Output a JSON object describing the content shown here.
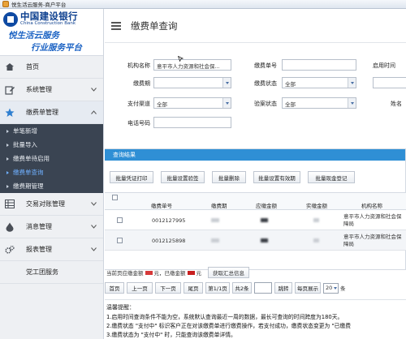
{
  "window": {
    "title": "悦生活云服务-商户平台"
  },
  "brand": {
    "bank_cn": "中国建设银行",
    "bank_en": "China Construction Bank",
    "slogan1": "悦生活云服务",
    "slogan2": "行业服务平台"
  },
  "sidebar": {
    "items": [
      {
        "label": "首页",
        "icon": "home-icon"
      },
      {
        "label": "系统管理",
        "icon": "edit-icon"
      },
      {
        "label": "缴费单管理",
        "icon": "star-icon"
      },
      {
        "label": "交易对账管理",
        "icon": "grid-icon"
      },
      {
        "label": "消息管理",
        "icon": "drop-icon"
      },
      {
        "label": "报表管理",
        "icon": "gears-icon"
      },
      {
        "label": "党工团服务",
        "icon": ""
      }
    ],
    "sub_items": [
      {
        "label": "单笔新增"
      },
      {
        "label": "批量导入"
      },
      {
        "label": "缴费单待启用"
      },
      {
        "label": "缴费单查询"
      },
      {
        "label": "缴费期管理"
      }
    ]
  },
  "header": {
    "title": "缴费单查询"
  },
  "form": {
    "org_label": "机构名称",
    "org_value": "意平市人力资源和社会保...",
    "bill_no_label": "缴费单号",
    "enable_time_label": "启用时间",
    "period_label": "缴费期",
    "pay_status_label": "缴费状态",
    "pay_status_value": "全部",
    "channel_label": "支付渠道",
    "channel_value": "全部",
    "verify_status_label": "验案状态",
    "verify_status_value": "全部",
    "name_label": "姓名",
    "phone_label": "电话号码"
  },
  "results": {
    "header": "查询结果",
    "buttons": [
      "批量凭证打印",
      "批量设置验签",
      "批量删除",
      "批量设置有效期",
      "批量现金登记"
    ],
    "columns": [
      "缴费单号",
      "缴费期",
      "应缴金额",
      "实缴金额",
      "机构名称"
    ],
    "rows": [
      {
        "bill_no": "0012127995",
        "org": "意平市人力资源和社会保障局"
      },
      {
        "bill_no": "0012125898",
        "org": "意平市人力资源和社会保障局"
      }
    ]
  },
  "summary": {
    "prefix": "当前页应缴金额",
    "mid": "元，已缴金额",
    "suffix": "元",
    "button": "获取汇总信息",
    "due_color": "#d63a3a",
    "paid_color": "#c81f1f"
  },
  "pager": {
    "first": "首页",
    "prev": "上一页",
    "next": "下一页",
    "last": "尾页",
    "page_info": "第1/1页",
    "total": "共2条",
    "jump": "跳转",
    "per_page_label": "每页展示",
    "per_page_value": "20",
    "unit": "条"
  },
  "tips": {
    "title": "温馨提醒：",
    "lines": [
      "1.启用时间查询条件不能为空，系统默认查询最近一周的数据，最长可查询的时间跨度为180天。",
      "2.缴费状态 \"支付中\" 标识客户正在对该缴费单进行缴费操作，若支付成功，缴费状态变更为 \"已缴费",
      "3.缴费状态为 \"支付中\" 时，只能查询该缴费单详情。"
    ]
  },
  "colors": {
    "accent": "#2f8fd5",
    "sidebar_dark": "#3a4452",
    "brand_blue": "#0c3f8f"
  }
}
